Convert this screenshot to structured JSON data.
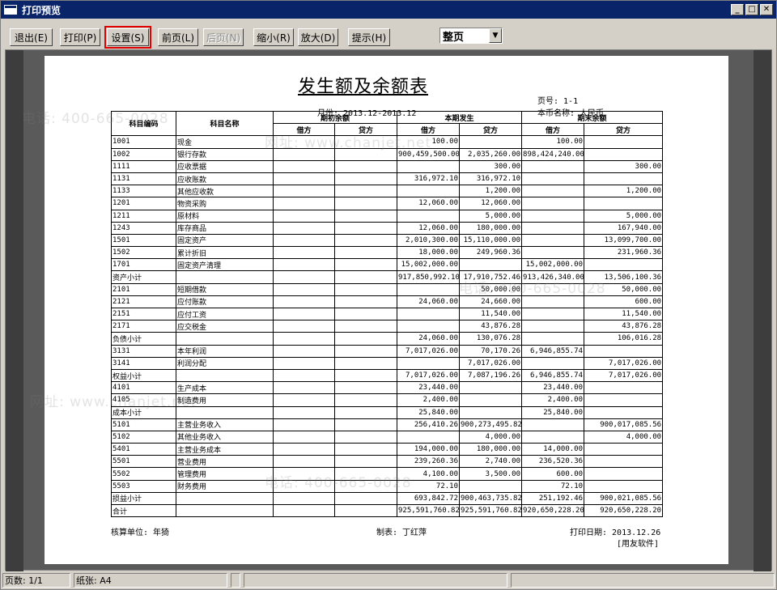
{
  "window": {
    "title": "打印预览",
    "min_glyph": "_",
    "max_glyph": "□",
    "close_glyph": "✕"
  },
  "toolbar": {
    "buttons": [
      {
        "label": "退出(E)",
        "disabled": false
      },
      {
        "label": "打印(P)",
        "disabled": false
      },
      {
        "label": "设置(S)",
        "disabled": false
      },
      {
        "label": "前页(L)",
        "disabled": false
      },
      {
        "label": "后页(N)",
        "disabled": true
      },
      {
        "label": "缩小(R)",
        "disabled": false
      },
      {
        "label": "放大(D)",
        "disabled": false
      },
      {
        "label": "提示(H)",
        "disabled": false
      }
    ],
    "page_mode": "整页",
    "highlight_color": "#e00000"
  },
  "watermark": {
    "phone": "电话: 400-665-0028",
    "site": "网址: www.chanjet.net"
  },
  "report": {
    "title": "发生额及余额表",
    "page_no": "页号:  1-1",
    "month": "月份: 2013.12-2013.12",
    "currency": "本币名称: 人民币",
    "headers": {
      "code": "科目编码",
      "name": "科目名称",
      "opening": "期初余额",
      "period": "本期发生",
      "closing": "期末余额",
      "debit": "借方",
      "credit": "贷方"
    },
    "rows": [
      [
        "1001",
        "现金",
        "",
        "",
        "100.00",
        "",
        "100.00",
        ""
      ],
      [
        "1002",
        "银行存款",
        "",
        "",
        "900,459,500.00",
        "2,035,260.00",
        "898,424,240.00",
        ""
      ],
      [
        "1111",
        "应收票据",
        "",
        "",
        "",
        "300.00",
        "",
        "300.00"
      ],
      [
        "1131",
        "应收账款",
        "",
        "",
        "316,972.10",
        "316,972.10",
        "",
        ""
      ],
      [
        "1133",
        "其他应收款",
        "",
        "",
        "",
        "1,200.00",
        "",
        "1,200.00"
      ],
      [
        "1201",
        "物资采购",
        "",
        "",
        "12,060.00",
        "12,060.00",
        "",
        ""
      ],
      [
        "1211",
        "原材料",
        "",
        "",
        "",
        "5,000.00",
        "",
        "5,000.00"
      ],
      [
        "1243",
        "库存商品",
        "",
        "",
        "12,060.00",
        "180,000.00",
        "",
        "167,940.00"
      ],
      [
        "1501",
        "固定资产",
        "",
        "",
        "2,010,300.00",
        "15,110,000.00",
        "",
        "13,099,700.00"
      ],
      [
        "1502",
        "累计折旧",
        "",
        "",
        "18,000.00",
        "249,960.36",
        "",
        "231,960.36"
      ],
      [
        "1701",
        "固定资产清理",
        "",
        "",
        "15,002,000.00",
        "",
        "15,002,000.00",
        ""
      ],
      [
        "资产小计",
        "",
        "",
        "",
        "917,850,992.10",
        "17,910,752.46",
        "913,426,340.00",
        "13,506,100.36"
      ],
      [
        "2101",
        "短期借款",
        "",
        "",
        "",
        "50,000.00",
        "",
        "50,000.00"
      ],
      [
        "2121",
        "应付账款",
        "",
        "",
        "24,060.00",
        "24,660.00",
        "",
        "600.00"
      ],
      [
        "2151",
        "应付工资",
        "",
        "",
        "",
        "11,540.00",
        "",
        "11,540.00"
      ],
      [
        "2171",
        "应交税金",
        "",
        "",
        "",
        "43,876.28",
        "",
        "43,876.28"
      ],
      [
        "负债小计",
        "",
        "",
        "",
        "24,060.00",
        "130,076.28",
        "",
        "106,016.28"
      ],
      [
        "3131",
        "本年利润",
        "",
        "",
        "7,017,026.00",
        "70,170.26",
        "6,946,855.74",
        ""
      ],
      [
        "3141",
        "利润分配",
        "",
        "",
        "",
        "7,017,026.00",
        "",
        "7,017,026.00"
      ],
      [
        "权益小计",
        "",
        "",
        "",
        "7,017,026.00",
        "7,087,196.26",
        "6,946,855.74",
        "7,017,026.00"
      ],
      [
        "4101",
        "生产成本",
        "",
        "",
        "23,440.00",
        "",
        "23,440.00",
        ""
      ],
      [
        "4105",
        "制造费用",
        "",
        "",
        "2,400.00",
        "",
        "2,400.00",
        ""
      ],
      [
        "成本小计",
        "",
        "",
        "",
        "25,840.00",
        "",
        "25,840.00",
        ""
      ],
      [
        "5101",
        "主营业务收入",
        "",
        "",
        "256,410.26",
        "900,273,495.82",
        "",
        "900,017,085.56"
      ],
      [
        "5102",
        "其他业务收入",
        "",
        "",
        "",
        "4,000.00",
        "",
        "4,000.00"
      ],
      [
        "5401",
        "主营业务成本",
        "",
        "",
        "194,000.00",
        "180,000.00",
        "14,000.00",
        ""
      ],
      [
        "5501",
        "营业费用",
        "",
        "",
        "239,260.36",
        "2,740.00",
        "236,520.36",
        ""
      ],
      [
        "5502",
        "管理费用",
        "",
        "",
        "4,100.00",
        "3,500.00",
        "600.00",
        ""
      ],
      [
        "5503",
        "财务费用",
        "",
        "",
        "72.10",
        "",
        "72.10",
        ""
      ],
      [
        "损益小计",
        "",
        "",
        "",
        "693,842.72",
        "900,463,735.82",
        "251,192.46",
        "900,021,085.56"
      ],
      [
        "合计",
        "",
        "",
        "",
        "925,591,760.82",
        "925,591,760.82",
        "920,650,228.20",
        "920,650,228.20"
      ]
    ],
    "unit": "核算单位: 年猗",
    "maker": "制表: 丁红萍",
    "print_date": "打印日期: 2013.12.26",
    "software": "[用友软件]"
  },
  "status": {
    "pages": "页数: 1/1",
    "paper": "纸张: A4"
  }
}
